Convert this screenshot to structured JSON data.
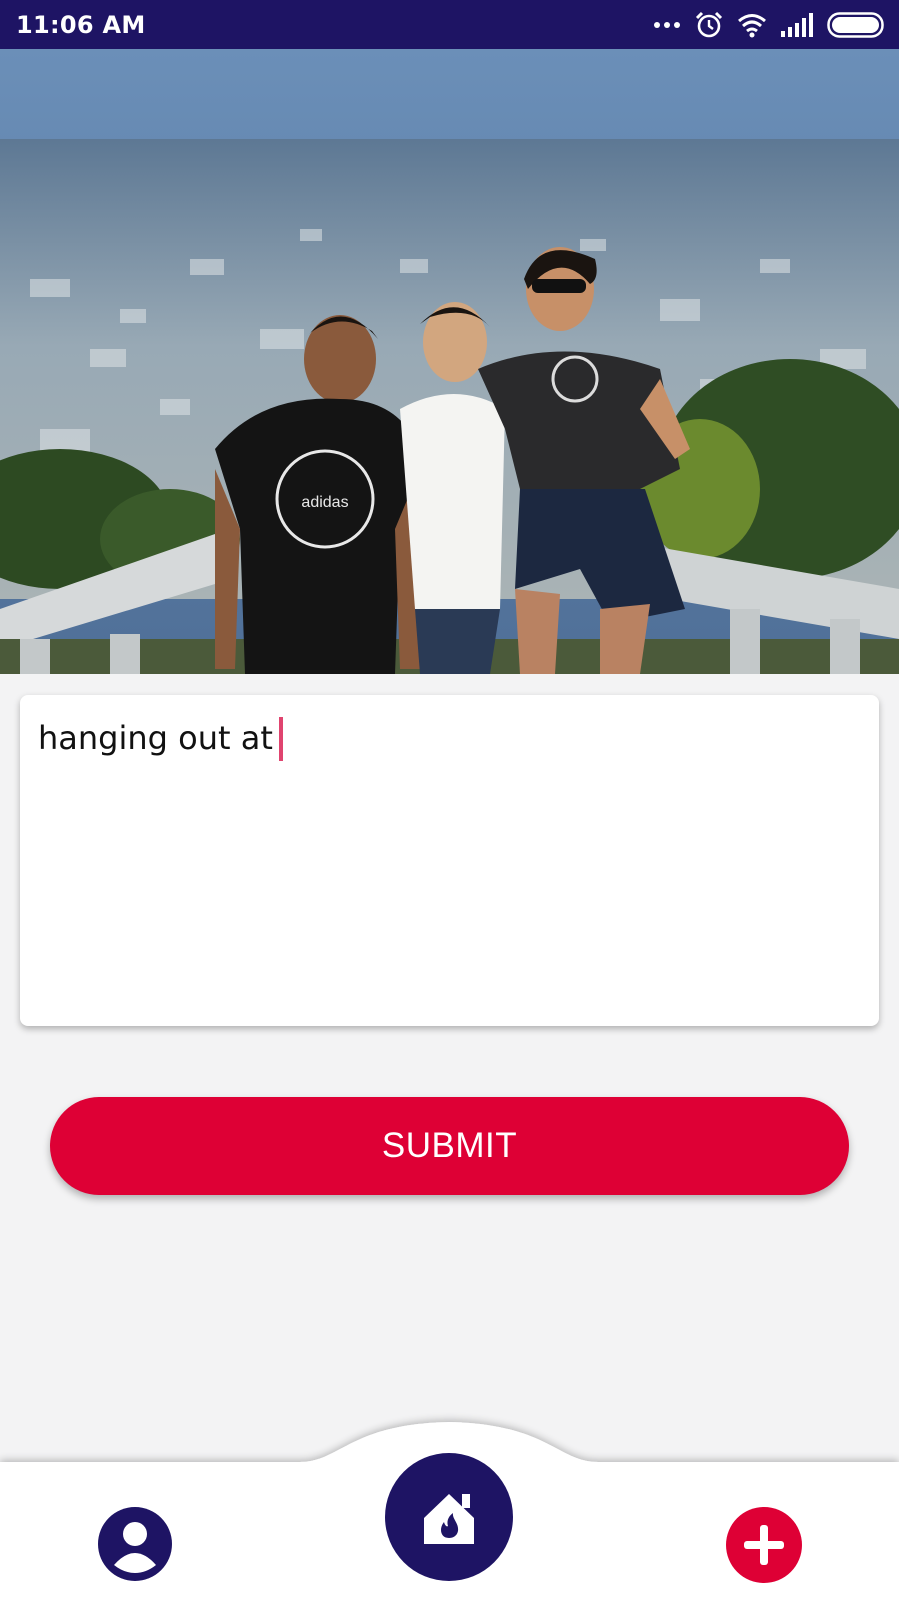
{
  "status_bar": {
    "time": "11:06 AM",
    "icons": [
      "more-dots-icon",
      "alarm-icon",
      "wifi-icon",
      "signal-icon",
      "battery-icon"
    ]
  },
  "photo": {
    "subject": "three friends posing at a viewpoint railing above a city"
  },
  "caption": {
    "value": "hanging out at"
  },
  "submit": {
    "label": "SUBMIT"
  },
  "nav": {
    "items": [
      "profile-icon",
      "home-flame-icon",
      "add-icon"
    ]
  },
  "colors": {
    "primary_navy": "#1e1464",
    "accent_red": "#de0035",
    "caret_pink": "#e0446f",
    "background": "#f3f3f4"
  }
}
